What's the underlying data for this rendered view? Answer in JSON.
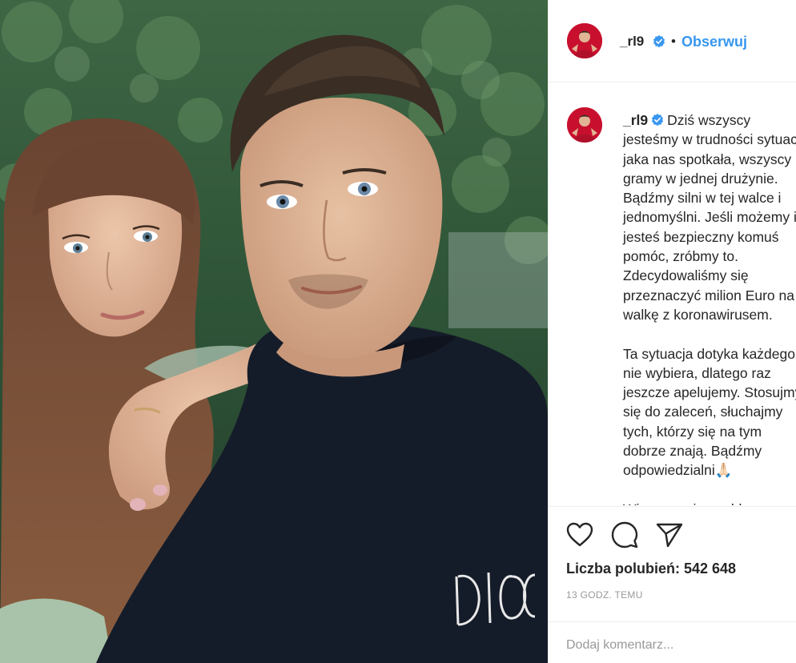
{
  "post": {
    "username": "_rl9",
    "follow_label": "Obserwuj",
    "separator": "•",
    "caption": "Dziś wszyscy jesteśmy w trudności sytuacji jaka nas spotkała, wszyscy gramy w jednej drużynie. Bądźmy silni w tej walce i jednomyślni. Jeśli możemy i jesteś bezpieczny komuś pomóc, zróbmy to. Zdecydowaliśmy się przeznaczyć milion Euro na walkę z koronawirusem.\n\nTa sytuacja dotyka każdego, nie wybiera, dlatego raz jeszcze apelujemy. Stosujmy się do zaleceń, słuchajmy tych, którzy się na tym dobrze znają. Bądźmy odpowiedzialni🙏🏻\n\nWierzymy, że szybko wrócimy do normalności. Bądźmy razem i solidarni. [ENG]\nWe are all aware of the difficult\nthe situation around us. We",
    "likes_text": "Liczba polubień: 542 648",
    "time_text": "13 GODZ. TEMU",
    "comment_placeholder": "Dodaj komentarz..."
  },
  "icons": {
    "like": "heart-icon",
    "comment": "comment-icon",
    "share": "paper-plane-icon",
    "verified": "verified-badge-icon"
  },
  "colors": {
    "link": "#3897f0",
    "verified": "#3897f0",
    "text": "#262626",
    "muted": "#999999",
    "avatar_bg": "#c8102e"
  }
}
